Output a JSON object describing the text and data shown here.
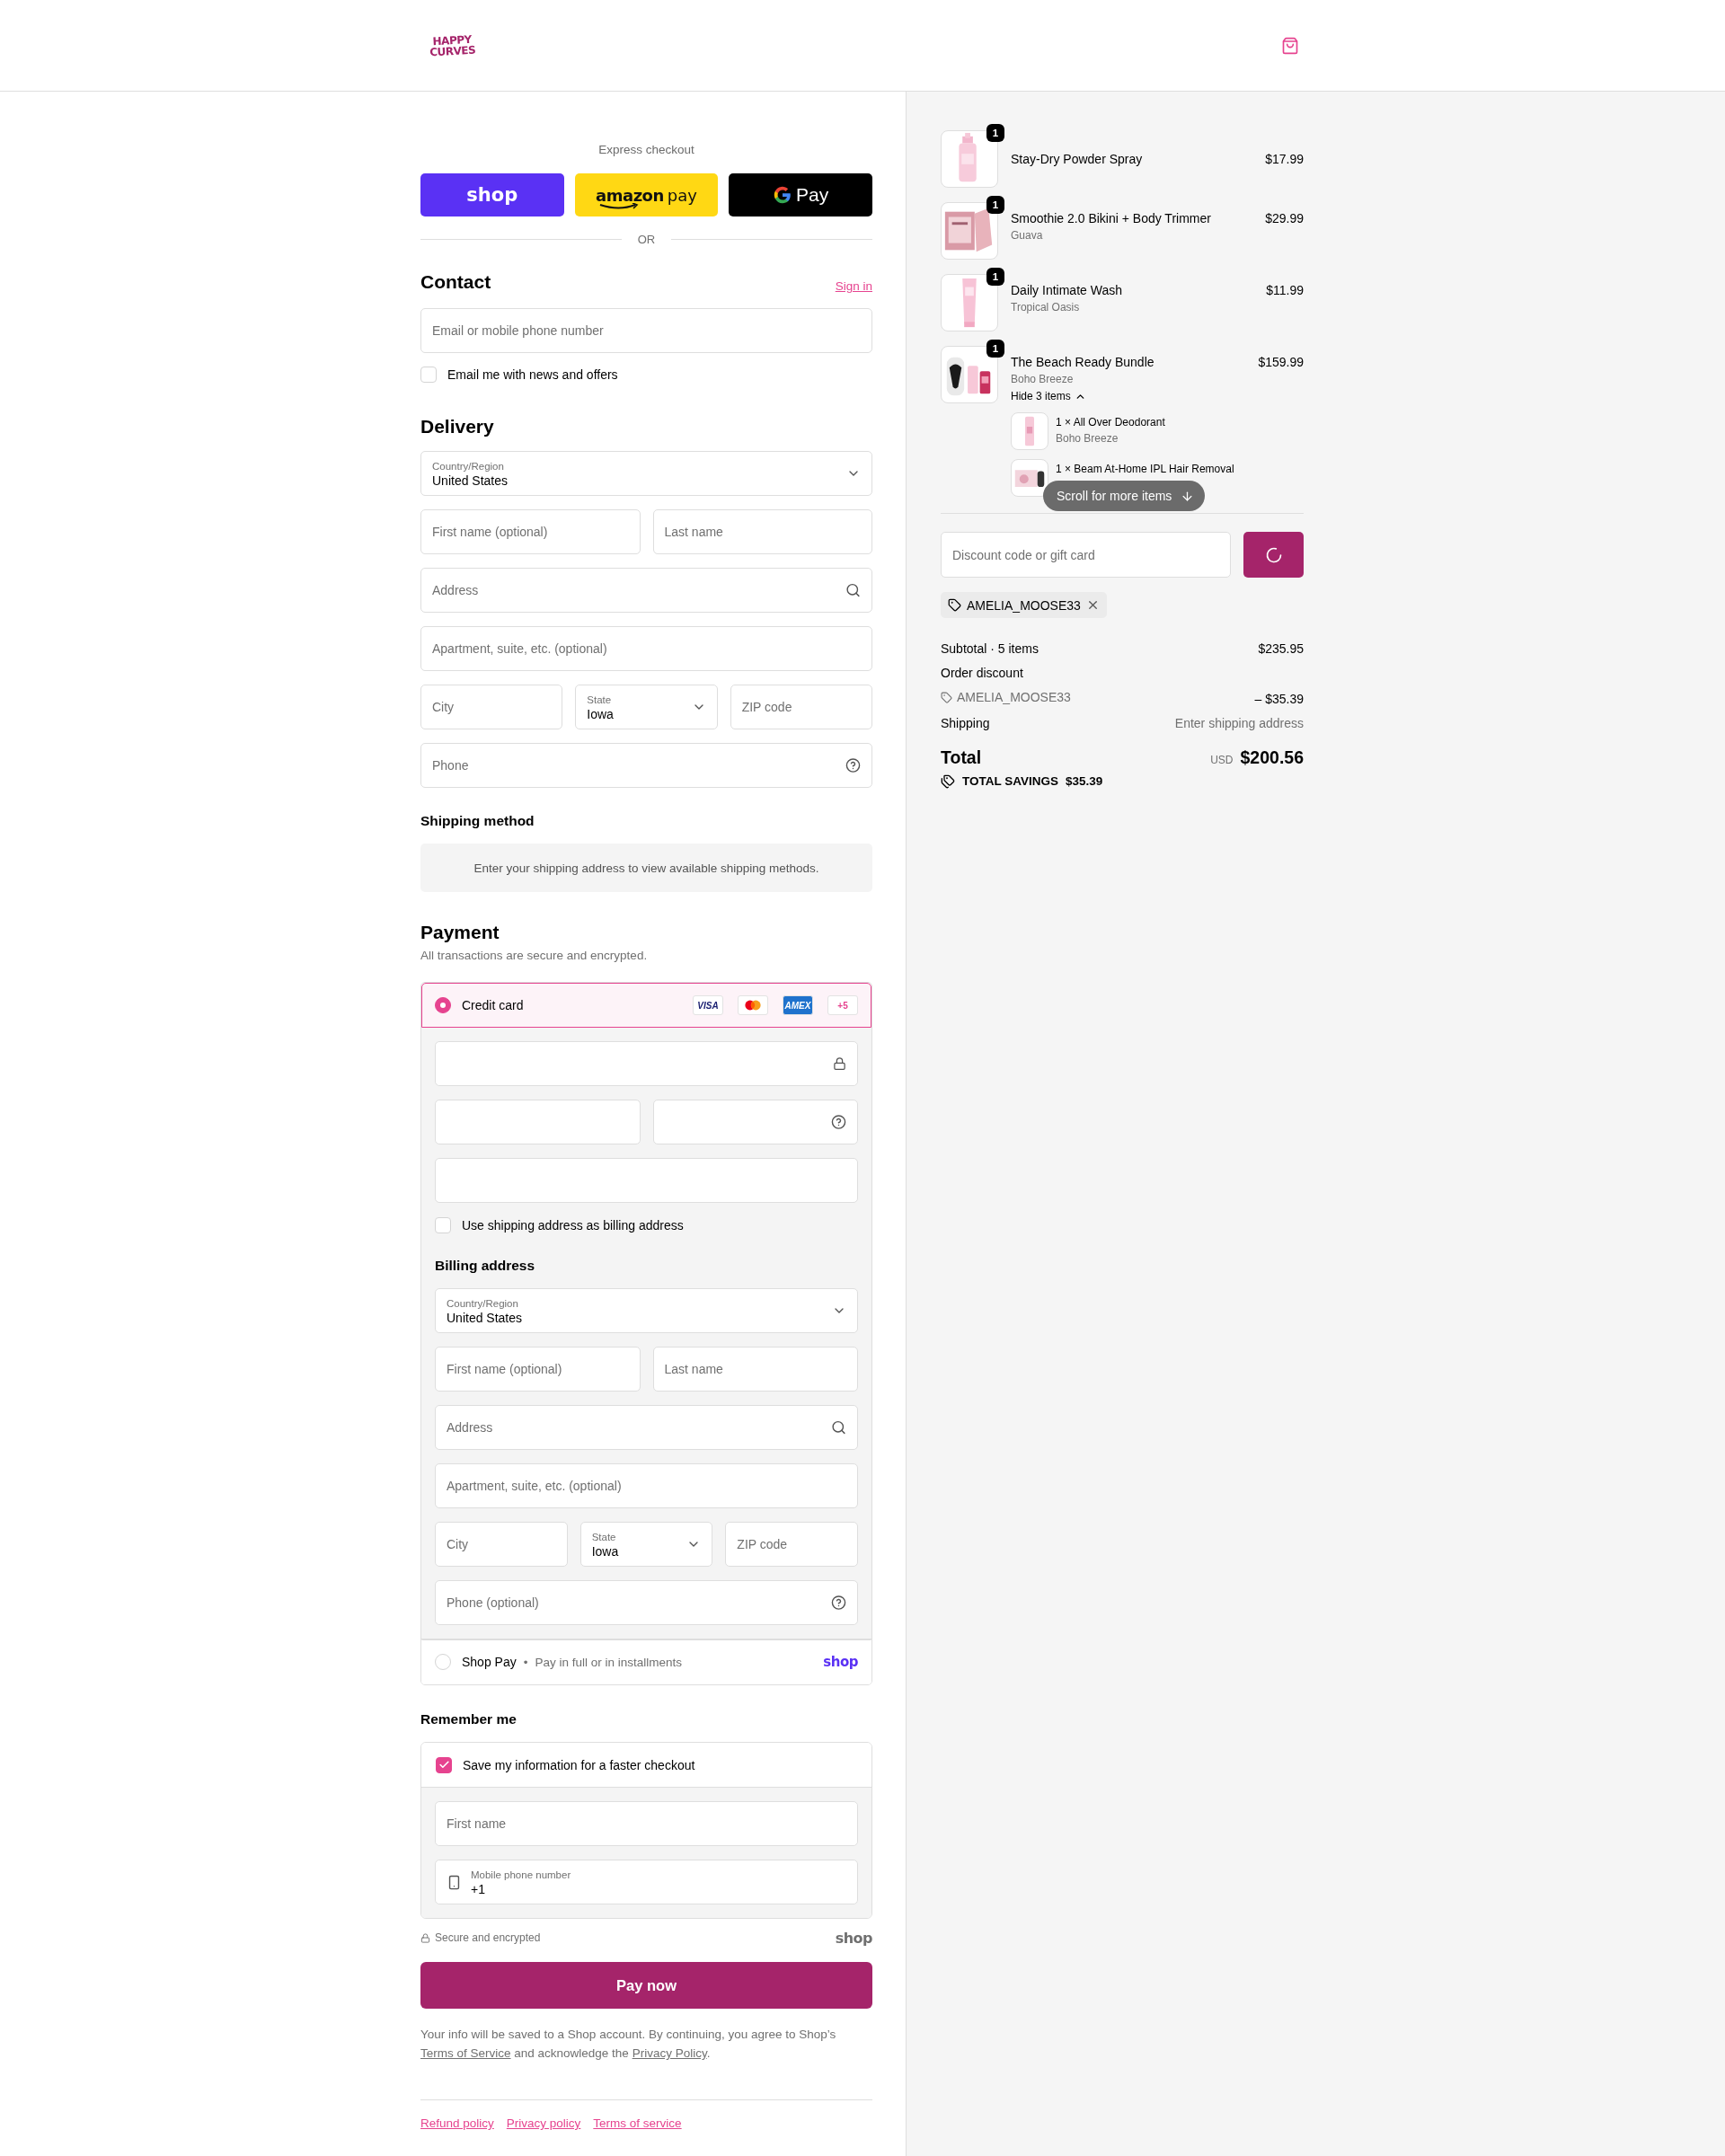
{
  "header": {
    "logo": [
      "HAPPY",
      "CURVES"
    ]
  },
  "express": {
    "title": "Express checkout",
    "buttons": [
      {
        "kind": "shop",
        "label": "shop"
      },
      {
        "kind": "amazon",
        "label": "amazon",
        "suffix": "pay"
      },
      {
        "kind": "gpay",
        "label": "Pay"
      }
    ],
    "separator": "OR"
  },
  "contact": {
    "title": "Contact",
    "sign_in": "Sign in",
    "email": {
      "placeholder": "Email or mobile phone number"
    },
    "newsletter": {
      "label": "Email me with news and offers",
      "checked": false
    }
  },
  "delivery": {
    "title": "Delivery",
    "rows": [
      [
        {
          "kind": "select",
          "label": "Country/Region",
          "value": "United States"
        }
      ],
      [
        {
          "kind": "text",
          "placeholder": "First name (optional)"
        },
        {
          "kind": "text",
          "placeholder": "Last name"
        }
      ],
      [
        {
          "kind": "address",
          "placeholder": "Address"
        }
      ],
      [
        {
          "kind": "text",
          "placeholder": "Apartment, suite, etc. (optional)"
        }
      ],
      [
        {
          "kind": "text",
          "placeholder": "City"
        },
        {
          "kind": "select",
          "label": "State",
          "value": "Iowa"
        },
        {
          "kind": "text",
          "placeholder": "ZIP code"
        }
      ],
      [
        {
          "kind": "phone",
          "placeholder": "Phone"
        }
      ]
    ]
  },
  "shipping": {
    "title": "Shipping method",
    "notice": "Enter your shipping address to view available shipping methods."
  },
  "payment": {
    "title": "Payment",
    "subtitle": "All transactions are secure and encrypted.",
    "methods": [
      {
        "kind": "card",
        "label": "Credit card",
        "selected": true,
        "brands": [
          {
            "kind": "visa",
            "label": "VISA"
          },
          {
            "kind": "mastercard"
          },
          {
            "kind": "amex",
            "label": "AMEX"
          },
          {
            "kind": "more",
            "label": "+5"
          }
        ],
        "card_rows": [
          [
            {
              "kind": "card_number"
            }
          ],
          [
            {
              "kind": "text"
            },
            {
              "kind": "security_code"
            }
          ],
          [
            {
              "kind": "text"
            }
          ]
        ],
        "billing_same": {
          "label": "Use shipping address as billing address",
          "checked": false
        },
        "billing": {
          "title": "Billing address",
          "rows": [
            [
              {
                "kind": "select",
                "label": "Country/Region",
                "value": "United States"
              }
            ],
            [
              {
                "kind": "text",
                "placeholder": "First name (optional)"
              },
              {
                "kind": "text",
                "placeholder": "Last name"
              }
            ],
            [
              {
                "kind": "address",
                "placeholder": "Address"
              }
            ],
            [
              {
                "kind": "text",
                "placeholder": "Apartment, suite, etc. (optional)"
              }
            ],
            [
              {
                "kind": "text",
                "placeholder": "City"
              },
              {
                "kind": "select",
                "label": "State",
                "value": "Iowa"
              },
              {
                "kind": "text",
                "placeholder": "ZIP code"
              }
            ],
            [
              {
                "kind": "phone",
                "placeholder": "Phone (optional)"
              }
            ]
          ]
        }
      },
      {
        "kind": "shop_pay",
        "label": "Shop Pay",
        "separator": "•",
        "detail": "Pay in full or in installments",
        "logo": "shop",
        "selected": false
      }
    ]
  },
  "remember": {
    "title": "Remember me",
    "save": {
      "label": "Save my information for a faster checkout",
      "checked": true
    },
    "first_name": {
      "placeholder": "First name"
    },
    "phone": {
      "label": "Mobile phone number",
      "value": "+1"
    }
  },
  "secure_note": {
    "label": "Secure and encrypted",
    "logo": "shop"
  },
  "pay_button": "Pay now",
  "legal": {
    "before": "Your info will be saved to a Shop account. By continuing, you agree to Shop’s ",
    "terms": "Terms of Service",
    "middle": " and acknowledge the ",
    "privacy": "Privacy Policy",
    "after": "."
  },
  "footer_links": [
    "Refund policy",
    "Privacy policy",
    "Terms of service"
  ],
  "cart": {
    "items": [
      {
        "name": "Stay-Dry Powder Spray",
        "price": "$17.99",
        "quantity": "1"
      },
      {
        "name": "Smoothie 2.0 Bikini + Body Trimmer",
        "variant": "Guava",
        "price": "$29.99",
        "quantity": "1"
      },
      {
        "name": "Daily Intimate Wash",
        "variant": "Tropical Oasis",
        "price": "$11.99",
        "quantity": "1"
      },
      {
        "name": "The Beach Ready Bundle",
        "variant": "Boho Breeze",
        "price": "$159.99",
        "quantity": "1",
        "toggle": "Hide 3 items",
        "expanded": true,
        "children": [
          {
            "name": "1 × All Over Deodorant",
            "variant": "Boho Breeze"
          },
          {
            "name": "1 × Beam At-Home IPL Hair Removal"
          }
        ]
      }
    ],
    "scroll_hint": "Scroll for more items",
    "discount": {
      "placeholder": "Discount code or gift card",
      "loading": true
    },
    "applied_code": "AMELIA_MOOSE33",
    "summary": {
      "subtotal_label": "Subtotal · 5 items",
      "subtotal": "$235.95",
      "discount_label": "Order discount",
      "discount_code": "AMELIA_MOOSE33",
      "discount_amount": "– $35.39",
      "shipping_label": "Shipping",
      "shipping": "Enter shipping address",
      "total_label": "Total",
      "currency": "USD",
      "total": "$200.56",
      "savings_label": "TOTAL SAVINGS",
      "savings": "$35.39"
    }
  }
}
